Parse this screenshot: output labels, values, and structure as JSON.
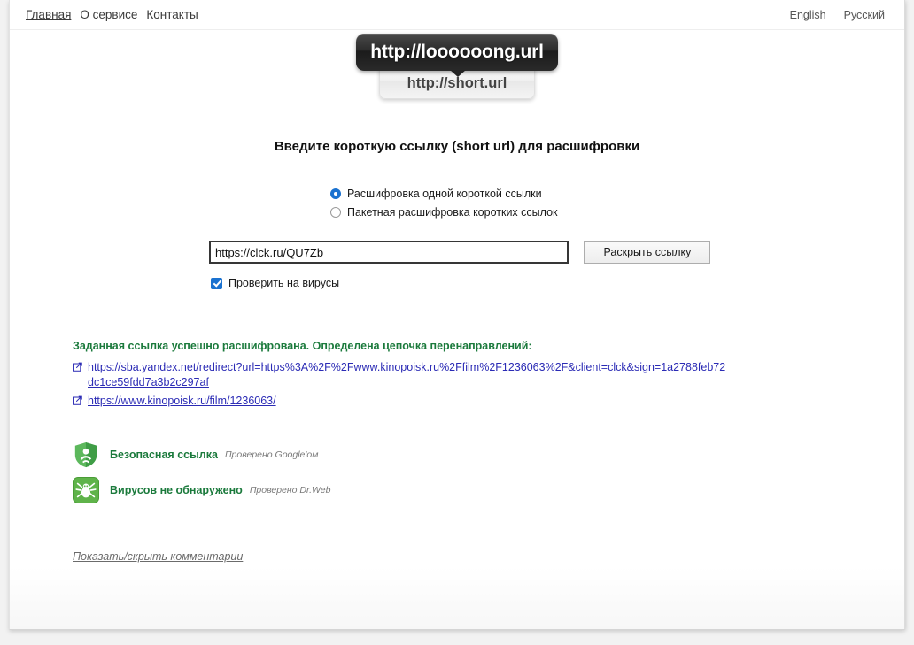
{
  "nav": {
    "left_items": [
      {
        "label": "Главная",
        "active": true
      },
      {
        "label": "О сервисе",
        "active": false
      },
      {
        "label": "Контакты",
        "active": false
      }
    ],
    "right_items": [
      {
        "label": "English"
      },
      {
        "label": "Русский"
      }
    ]
  },
  "logo": {
    "long_url": "http://loooooong.url",
    "short_url": "http://short.url"
  },
  "headline": "Введите короткую ссылку (short url) для расшифровки",
  "form": {
    "mode_options": [
      {
        "label": "Расшифровка одной короткой ссылки",
        "selected": true
      },
      {
        "label": "Пакетная расшифровка коротких ссылок",
        "selected": false
      }
    ],
    "url_value": "https://clck.ru/QU7Zb",
    "url_placeholder": "https://clck.ru/QU7Zb",
    "submit_label": "Раскрыть ссылку",
    "virus_check_label": "Проверить на вирусы",
    "virus_check_checked": true
  },
  "result": {
    "status_text": "Заданная ссылка успешно расшифрована. Определена цепочка перенаправлений:",
    "chain": [
      "https://sba.yandex.net/redirect?url=https%3A%2F%2Fwww.kinopoisk.ru%2Ffilm%2F1236063%2F&client=clck&sign=1a2788feb72dc1ce59fdd7a3b2c297af",
      "https://www.kinopoisk.ru/film/1236063/"
    ]
  },
  "badges": [
    {
      "icon": "green-shield-icon",
      "title": "Безопасная ссылка",
      "subtitle": "Проверено Google'ом"
    },
    {
      "icon": "drweb-spider-icon",
      "title": "Вирусов не обнаружено",
      "subtitle": "Проверено Dr.Web"
    }
  ],
  "comments_link": "Показать/скрыть комментарии",
  "colors": {
    "accent_blue": "#1b72d0",
    "success_green": "#1b7a3c",
    "link_blue": "#2b2bb5",
    "badge_green": "#4aa03f"
  }
}
